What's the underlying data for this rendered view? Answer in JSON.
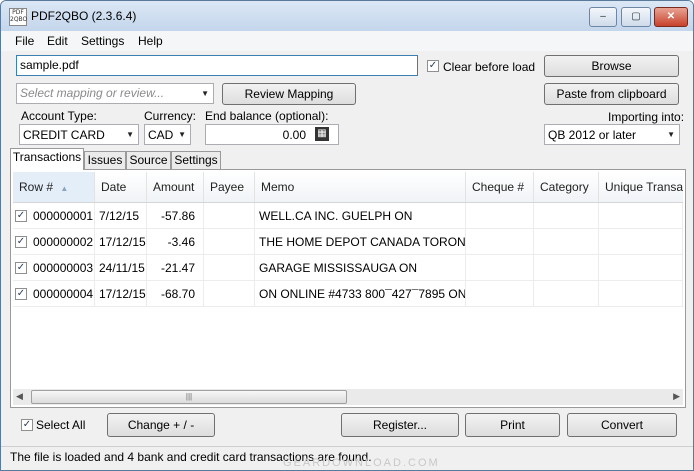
{
  "window": {
    "title": "PDF2QBO (2.3.6.4)",
    "app_icon_text": "PDF 2QBO"
  },
  "window_controls": {
    "minimize": "–",
    "maximize": "▢",
    "close": "✕"
  },
  "menu": [
    "File",
    "Edit",
    "Settings",
    "Help"
  ],
  "file": {
    "value": "sample.pdf"
  },
  "clear_before_load": {
    "label": "Clear before load",
    "checked": true,
    "mark": "✓"
  },
  "browse_label": "Browse",
  "mapping": {
    "placeholder": "Select mapping or review...",
    "arrow": "▼"
  },
  "review_mapping_label": "Review Mapping",
  "paste_label": "Paste from clipboard",
  "account_type": {
    "label": "Account Type:",
    "value": "CREDIT CARD"
  },
  "currency": {
    "label": "Currency:",
    "value": "CAD"
  },
  "end_balance": {
    "label": "End balance (optional):",
    "value": "0.00",
    "calc_icon": "▦"
  },
  "importing_into": {
    "label": "Importing into:",
    "value": "QB 2012 or later"
  },
  "tabs": [
    "Transactions",
    "Issues",
    "Source",
    "Settings"
  ],
  "columns": {
    "row": "Row #",
    "sort_indicator": "▲",
    "date": "Date",
    "amount": "Amount",
    "payee": "Payee",
    "memo": "Memo",
    "cheque": "Cheque #",
    "category": "Category",
    "unique": "Unique Transact"
  },
  "rows": [
    {
      "checked": true,
      "row": "000000001",
      "date": "7/12/15",
      "amount": "-57.86",
      "payee": "",
      "memo": "WELL.CA INC. GUELPH ON",
      "cheque": "",
      "category": "",
      "unique": ""
    },
    {
      "checked": true,
      "row": "000000002",
      "date": "17/12/15",
      "amount": "-3.46",
      "payee": "",
      "memo": "THE HOME DEPOT CANADA TORONTO ON",
      "cheque": "",
      "category": "",
      "unique": ""
    },
    {
      "checked": true,
      "row": "000000003",
      "date": "24/11/15",
      "amount": "-21.47",
      "payee": "",
      "memo": "GARAGE MISSISSAUGA ON",
      "cheque": "",
      "category": "",
      "unique": ""
    },
    {
      "checked": true,
      "row": "000000004",
      "date": "17/12/15",
      "amount": "-68.70",
      "payee": "",
      "memo": "ON ONLINE #4733 800¯427¯7895 ON",
      "cheque": "",
      "category": "",
      "unique": ""
    }
  ],
  "check_mark": "✓",
  "scrollbar": {
    "left_arrow": "◀",
    "right_arrow": "▶",
    "grip": "|||"
  },
  "select_all": {
    "label": "Select All",
    "checked": true
  },
  "buttons": {
    "change": "Change + / -",
    "register": "Register...",
    "print": "Print",
    "convert": "Convert"
  },
  "status": "The file is loaded and 4 bank and credit card transactions are found.",
  "watermark": "GEARDOWNLOAD.COM"
}
